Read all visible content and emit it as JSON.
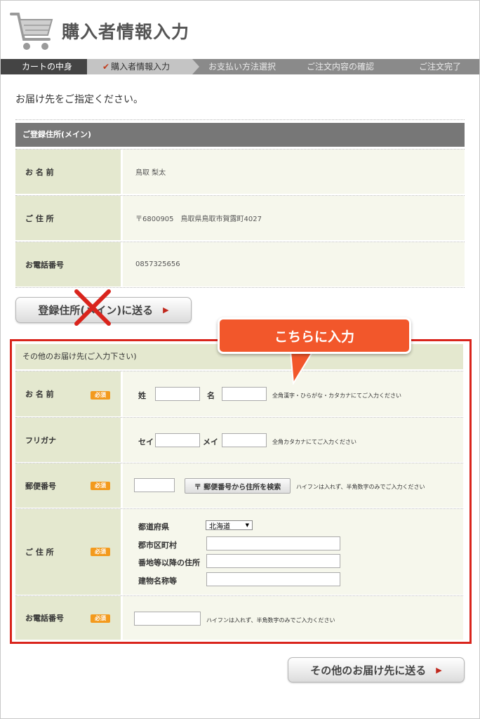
{
  "header": {
    "title": "購入者情報入力",
    "icon": "shopping-cart-icon"
  },
  "steps": [
    {
      "label": "カートの中身"
    },
    {
      "label": "購入者情報入力",
      "check": "✔"
    },
    {
      "label": "お支払い方法選択"
    },
    {
      "label": "ご注文内容の確認"
    },
    {
      "label": "ご注文完了"
    }
  ],
  "instruction": "お届け先をご指定ください。",
  "registered": {
    "heading": "ご登録住所(メイン)",
    "name_label": "お 名 前",
    "name_value": "鳥取 梨太",
    "address_label": "ご 住 所",
    "address_value": "〒6800905　鳥取県鳥取市賀露町4027",
    "phone_label": "お電話番号",
    "phone_value": "0857325656",
    "send_button": "登録住所(メイン)に送る"
  },
  "callout": "こちらに入力",
  "other": {
    "heading": "その他のお届け先(ご入力下さい)",
    "required_badge": "必須",
    "name_label": "お 名 前",
    "last_name_label": "姓",
    "first_name_label": "名",
    "name_note": "全角漢字・ひらがな・カタカナにてご入力ください",
    "furigana_label": "フリガナ",
    "sei_label": "セイ",
    "mei_label": "メイ",
    "furigana_note": "全角カタカナにてご入力ください",
    "postal_label": "郵便番号",
    "postal_search_button": "〒 郵便番号から住所を検索",
    "postal_note": "ハイフンは入れず、半角数字のみでご入力ください",
    "address_label": "ご 住 所",
    "prefecture_label": "都道府県",
    "prefecture_value": "北海道",
    "city_label": "郡市区町村",
    "street_label": "番地等以降の住所",
    "building_label": "建物名称等",
    "phone_label": "お電話番号",
    "phone_note": "ハイフンは入れず、半角数字のみでご入力ください",
    "send_button": "その他のお届け先に送る"
  },
  "colors": {
    "accent_red": "#d9241c",
    "callout_orange": "#f2572b",
    "required_orange": "#f39a1d",
    "label_bg": "#e4e8cf",
    "cell_bg": "#f6f7ec"
  }
}
